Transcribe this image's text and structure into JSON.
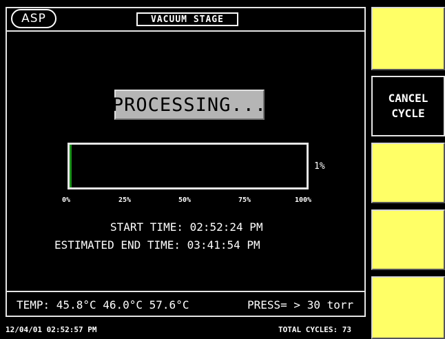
{
  "header": {
    "logo_text": "ASP",
    "stage_title": "VACUUM STAGE"
  },
  "status": {
    "processing_text": "PROCESSING..."
  },
  "progress": {
    "value_percent": 1,
    "label": "1%",
    "ticks": [
      "0%",
      "25%",
      "50%",
      "75%",
      "100%"
    ]
  },
  "times": {
    "start_label": "START TIME:",
    "start_value": "02:52:24 PM",
    "end_label": "ESTIMATED END TIME:",
    "end_value": "03:41:54 PM"
  },
  "readings": {
    "temp_text": "TEMP: 45.8°C 46.0°C 57.6°C",
    "press_text": "PRESS= > 30 torr"
  },
  "footer": {
    "datetime": "12/04/01 02:52:57 PM",
    "total_cycles": "TOTAL CYCLES: 73"
  },
  "side_buttons": [
    {
      "label": ""
    },
    {
      "label_line1": "CANCEL",
      "label_line2": "CYCLE"
    },
    {
      "label": ""
    },
    {
      "label": ""
    },
    {
      "label": ""
    }
  ],
  "colors": {
    "button_yellow": "#ffff66",
    "progress_green": "#1a8f1a",
    "processing_gray": "#b5b5b5"
  }
}
